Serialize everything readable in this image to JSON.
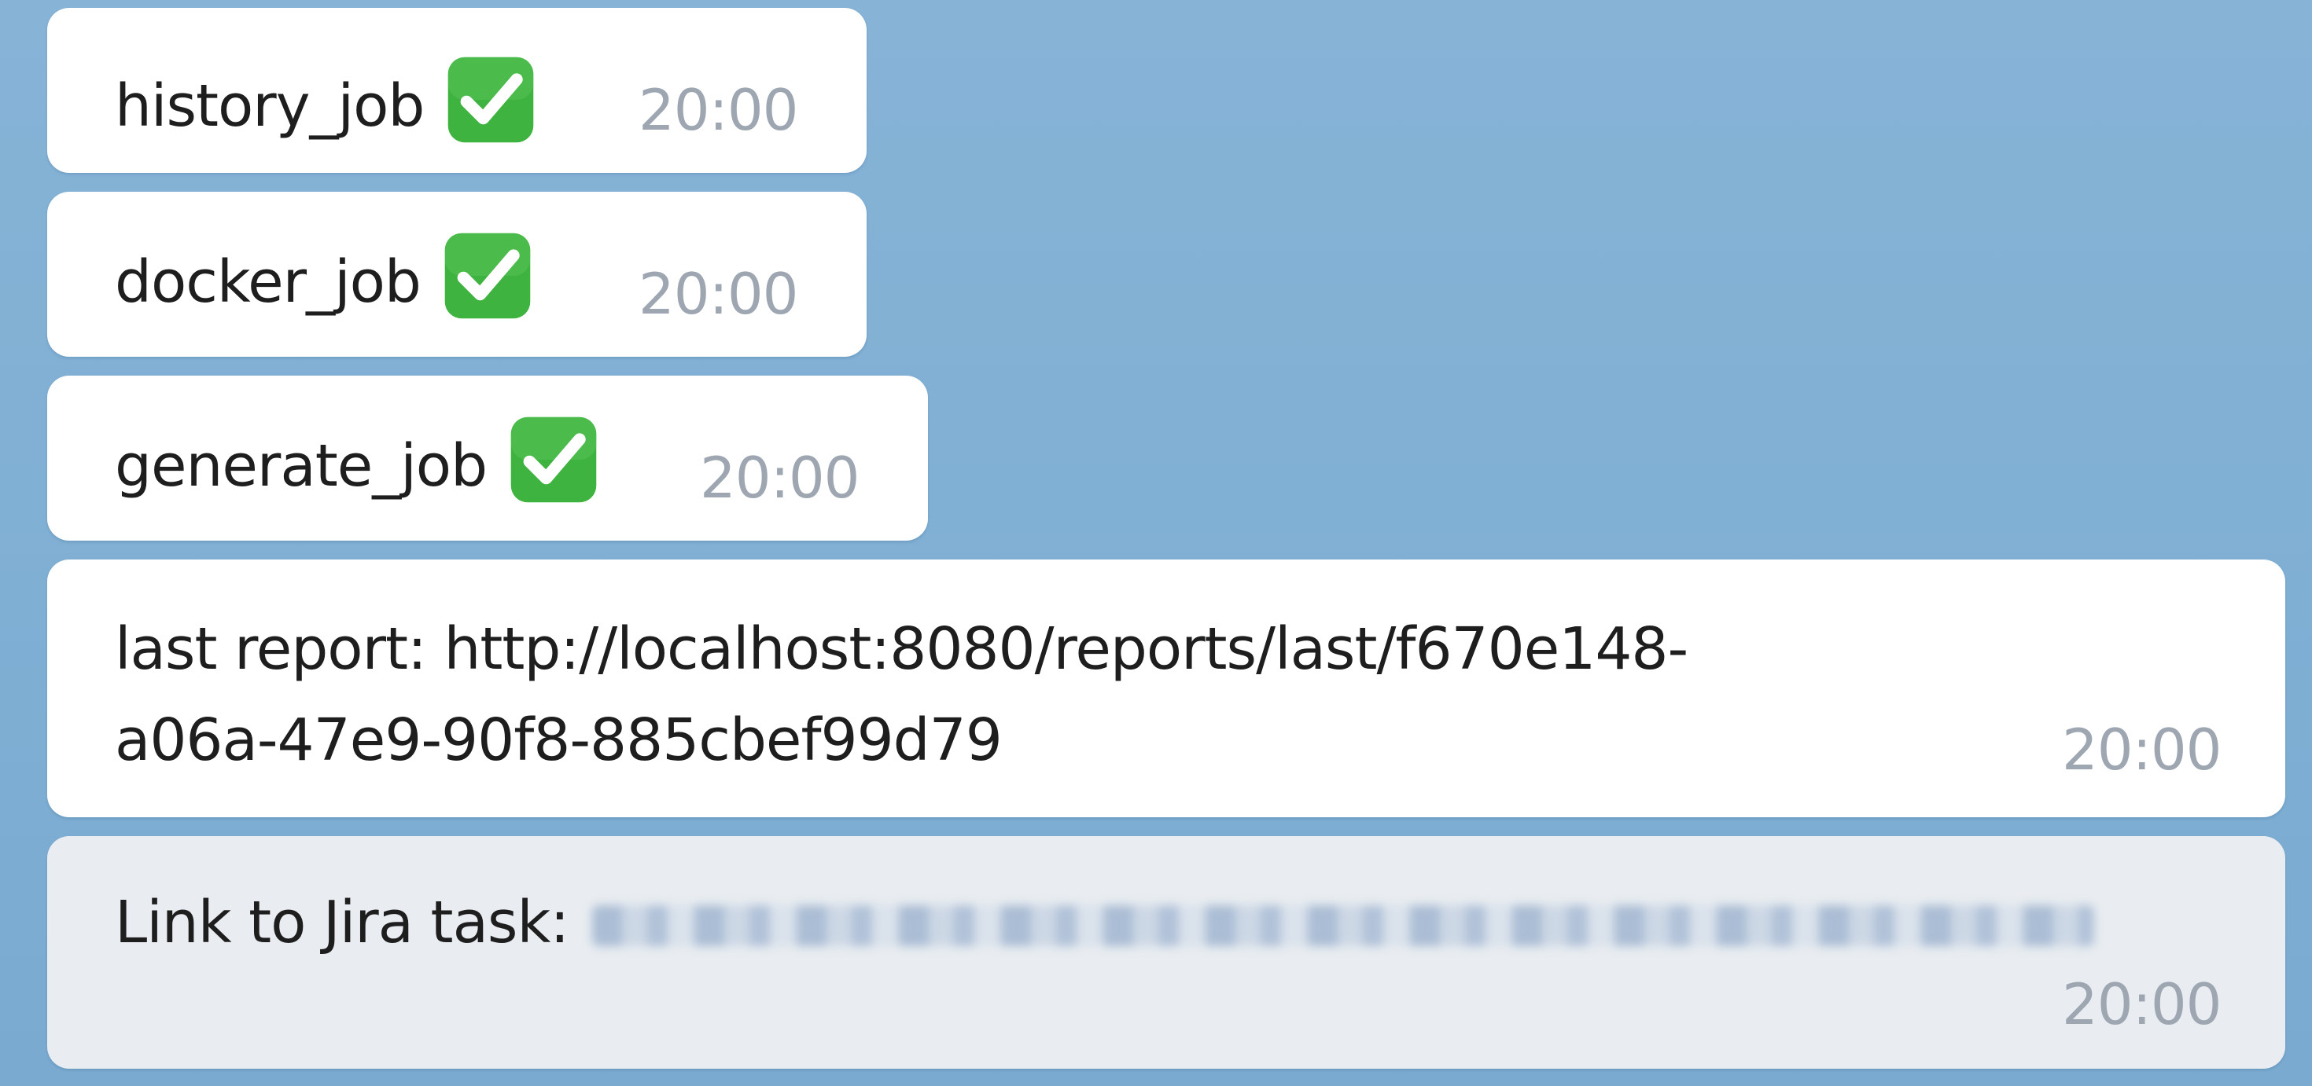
{
  "messages": [
    {
      "text": "history_job",
      "status_icon": "check-mark-button",
      "time": "20:00"
    },
    {
      "text": "docker_job",
      "status_icon": "check-mark-button",
      "time": "20:00"
    },
    {
      "text": "generate_job",
      "status_icon": "check-mark-button",
      "time": "20:00"
    },
    {
      "line1": "last report: http://localhost:8080/reports/last/f670e148-",
      "line2": "a06a-47e9-90f8-885cbef99d79",
      "time": "20:00"
    },
    {
      "text": "Link to Jira task:",
      "link_redacted": true,
      "time": "20:00"
    }
  ],
  "colors": {
    "chat_background": "#7fafd3",
    "bubble": "#ffffff",
    "check_green": "#3fb33f",
    "time_text": "#9ea7b1"
  }
}
